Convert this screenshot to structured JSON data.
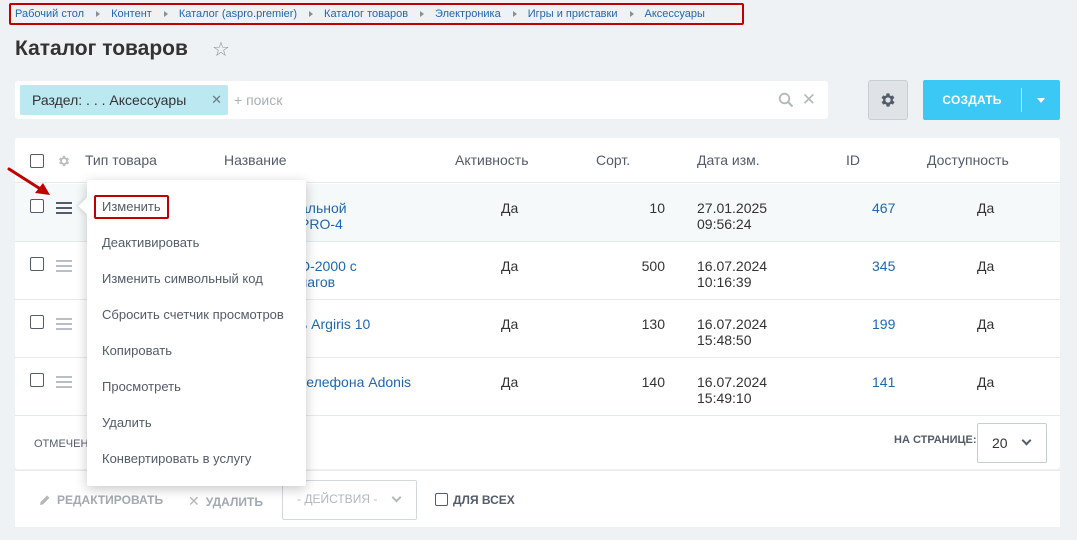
{
  "breadcrumb": [
    "Рабочий стол",
    "Контент",
    "Каталог (aspro.premier)",
    "Каталог товаров",
    "Электроника",
    "Игры и приставки",
    "Аксессуары"
  ],
  "page_title": "Каталог товаров",
  "filter": {
    "chip_label": "Раздел: . . . Аксессуары",
    "add_label": "+ поиск"
  },
  "toolbar": {
    "create_label": "СОЗДАТЬ"
  },
  "table": {
    "columns": [
      "Тип товара",
      "Название",
      "Активность",
      "Сорт.",
      "Дата изм.",
      "ID",
      "Доступность"
    ],
    "rows": [
      {
        "name_line1": "альной",
        "name_line2": "PRO-4",
        "active": "Да",
        "sort": "10",
        "date": "27.01.2025",
        "time": "09:56:24",
        "id": "467",
        "available": "Да"
      },
      {
        "name_line1": "D-2000 с",
        "name_line2": "чагов",
        "active": "Да",
        "sort": "500",
        "date": "16.07.2024",
        "time": "10:16:39",
        "id": "345",
        "available": "Да"
      },
      {
        "name_line1": "ь Argiris 10",
        "name_line2": "",
        "active": "Да",
        "sort": "130",
        "date": "16.07.2024",
        "time": "15:48:50",
        "id": "199",
        "available": "Да"
      },
      {
        "name_line1": "телефона Adonis",
        "name_line2": "",
        "active": "Да",
        "sort": "140",
        "date": "16.07.2024",
        "time": "15:49:10",
        "id": "141",
        "available": "Да"
      }
    ],
    "footer_marked_label": "ОТМЕЧЕН",
    "per_page_label": "НА СТРАНИЦЕ:",
    "per_page_value": "20"
  },
  "context_menu": {
    "items": [
      "Изменить",
      "Деактивировать",
      "Изменить символьный код",
      "Сбросить счетчик просмотров",
      "Копировать",
      "Просмотреть",
      "Удалить",
      "Конвертировать в услугу"
    ]
  },
  "action_bar": {
    "edit_label": "РЕДАКТИРОВАТЬ",
    "delete_label": "УДАЛИТЬ",
    "actions_placeholder": "- ДЕЙСТВИЯ -",
    "for_all_label": "ДЛЯ ВСЕХ"
  },
  "colors": {
    "accent": "#3bc8f5",
    "link": "#2067b0",
    "chip": "#bce8f1",
    "annotation": "#c00000"
  }
}
